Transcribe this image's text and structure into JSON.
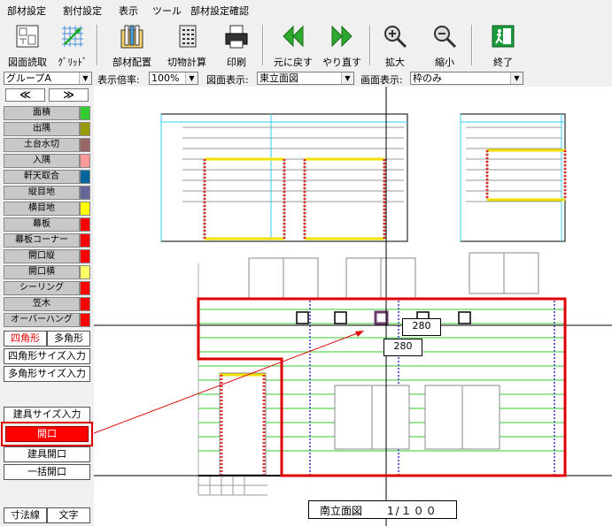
{
  "menu": [
    "部材設定",
    "割付設定",
    "表示",
    "ツール",
    "部材設定確認"
  ],
  "toolbar": [
    {
      "label": "図面読取",
      "icon": "drawing-read-icon"
    },
    {
      "label": "ｸﾞﾘｯﾄﾞ",
      "icon": "grid-icon"
    },
    {
      "label": "部材配置",
      "icon": "member-place-icon"
    },
    {
      "label": "切物計算",
      "icon": "cut-calc-icon"
    },
    {
      "label": "印刷",
      "icon": "printer-icon"
    },
    {
      "label": "元に戻す",
      "icon": "undo-icon"
    },
    {
      "label": "やり直す",
      "icon": "redo-icon"
    },
    {
      "label": "拡大",
      "icon": "zoom-in-icon"
    },
    {
      "label": "縮小",
      "icon": "zoom-out-icon"
    },
    {
      "label": "終了",
      "icon": "exit-icon"
    }
  ],
  "selectors": {
    "group": "グループA",
    "zoom_label": "表示倍率:",
    "zoom": "100%",
    "drawing_label": "図面表示:",
    "drawing": "東立面図",
    "screen_label": "画面表示:",
    "screen": "枠のみ"
  },
  "nav": {
    "prev": "≪",
    "next": "≫"
  },
  "layers": [
    {
      "name": "面積",
      "color": "#33cc33"
    },
    {
      "name": "出隅",
      "color": "#999900"
    },
    {
      "name": "土台水切",
      "color": "#996666"
    },
    {
      "name": "入隅",
      "color": "#ff9999"
    },
    {
      "name": "軒天取合",
      "color": "#006699"
    },
    {
      "name": "縦目地",
      "color": "#666699"
    },
    {
      "name": "横目地",
      "color": "#ffff00"
    },
    {
      "name": "幕板",
      "color": "#ff0000"
    },
    {
      "name": "幕板コーナー",
      "color": "#ff0000"
    },
    {
      "name": "開口縦",
      "color": "#ff0000"
    },
    {
      "name": "開口横",
      "color": "#ffff66"
    },
    {
      "name": "シーリング",
      "color": "#ff0000"
    },
    {
      "name": "笠木",
      "color": "#ff0000"
    },
    {
      "name": "オーバーハング",
      "color": "#ff0000"
    }
  ],
  "shape_tabs": {
    "rect": "四角形",
    "poly": "多角形"
  },
  "buttons": {
    "rect_size": "四角形サイズ入力",
    "poly_size": "多角形サイズ入力",
    "fitting_size": "建具サイズ入力",
    "opening": "開口",
    "fitting_opening": "建具開口",
    "bulk_opening": "一括開口",
    "dimension_line": "寸法線",
    "text": "文字"
  },
  "canvas": {
    "dimension_1": "280",
    "dimension_2": "280",
    "elevation_name": "南立面図",
    "scale": "1/１００"
  }
}
